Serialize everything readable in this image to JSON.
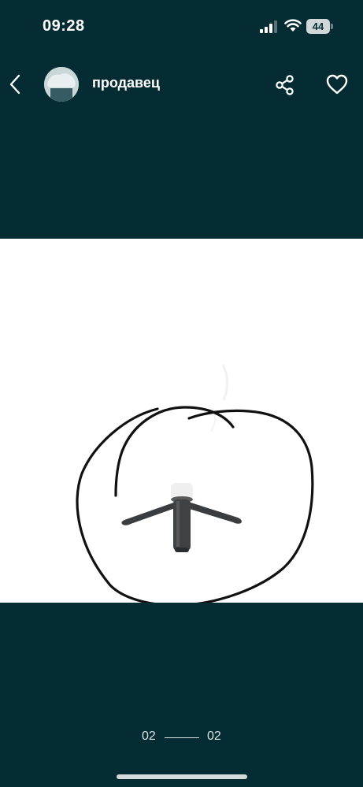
{
  "status_bar": {
    "time": "09:28",
    "battery_level": "44",
    "icons": [
      "signal-icon",
      "wifi-icon",
      "battery-icon"
    ]
  },
  "header": {
    "seller_name": "продавец",
    "icons": [
      "back-chevron-icon",
      "share-icon",
      "heart-icon"
    ]
  },
  "gallery": {
    "current": "02",
    "total": "02"
  },
  "colors": {
    "background": "#052c33",
    "image_background": "#ffffff",
    "text": "#ffffff"
  }
}
